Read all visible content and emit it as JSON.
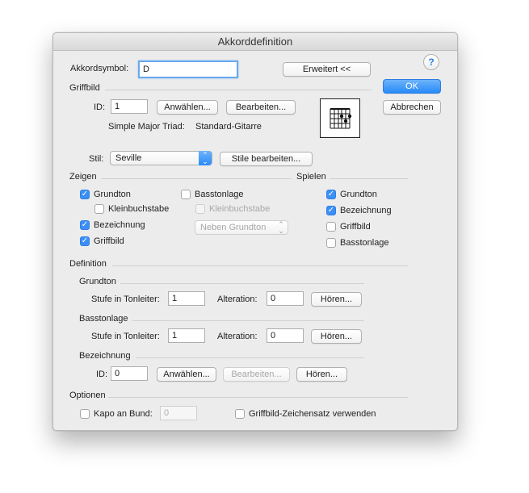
{
  "window": {
    "title": "Akkorddefinition"
  },
  "akkordsymbol": {
    "label": "Akkordsymbol:",
    "value": "D"
  },
  "erweitert_button": "Erweitert <<",
  "help_icon": "?",
  "ok_button": "OK",
  "abbrechen_button": "Abbrechen",
  "griffbild": {
    "section": "Griffbild",
    "id_label": "ID:",
    "id_value": "1",
    "anwaehlen": "Anwählen...",
    "bearbeiten": "Bearbeiten...",
    "name": "Simple Major Triad:",
    "instrument": "Standard-Gitarre"
  },
  "stil": {
    "label": "Stil:",
    "value": "Seville",
    "edit_button": "Stile bearbeiten..."
  },
  "zeigen": {
    "section": "Zeigen",
    "grundton": "Grundton",
    "kleinbuchstabe": "Kleinbuchstabe",
    "bezeichnung": "Bezeichnung",
    "griffbild": "Griffbild",
    "basstonlage": "Basstonlage",
    "bass_kleinbuchstabe": "Kleinbuchstabe",
    "position_popup": "Neben Grundton",
    "checked": {
      "grundton": true,
      "kleinbuchstabe": false,
      "bezeichnung": true,
      "griffbild": true,
      "basstonlage": false,
      "bass_kleinbuchstabe": false
    }
  },
  "spielen": {
    "section": "Spielen",
    "grundton": "Grundton",
    "bezeichnung": "Bezeichnung",
    "griffbild": "Griffbild",
    "basstonlage": "Basstonlage",
    "checked": {
      "grundton": true,
      "bezeichnung": true,
      "griffbild": false,
      "basstonlage": false
    }
  },
  "definition": {
    "section": "Definition",
    "grundton": {
      "section": "Grundton",
      "stufe_label": "Stufe in Tonleiter:",
      "stufe_value": "1",
      "alteration_label": "Alteration:",
      "alteration_value": "0",
      "hoeren": "Hören..."
    },
    "basstonlage": {
      "section": "Basstonlage",
      "stufe_label": "Stufe in Tonleiter:",
      "stufe_value": "1",
      "alteration_label": "Alteration:",
      "alteration_value": "0",
      "hoeren": "Hören..."
    },
    "bezeichnung": {
      "section": "Bezeichnung",
      "id_label": "ID:",
      "id_value": "0",
      "anwaehlen": "Anwählen...",
      "bearbeiten": "Bearbeiten...",
      "hoeren": "Hören..."
    }
  },
  "optionen": {
    "section": "Optionen",
    "kapo_label": "Kapo an Bund:",
    "kapo_value": "0",
    "zeichensatz_label": "Griffbild-Zeichensatz verwenden"
  },
  "icons": {
    "check": "✓",
    "updown": "⌃⌄",
    "help": "question-icon",
    "dropdown": "chevron-updown-icon"
  },
  "colors": {
    "accent": "#2a8af7",
    "window_bg": "#ececec"
  }
}
